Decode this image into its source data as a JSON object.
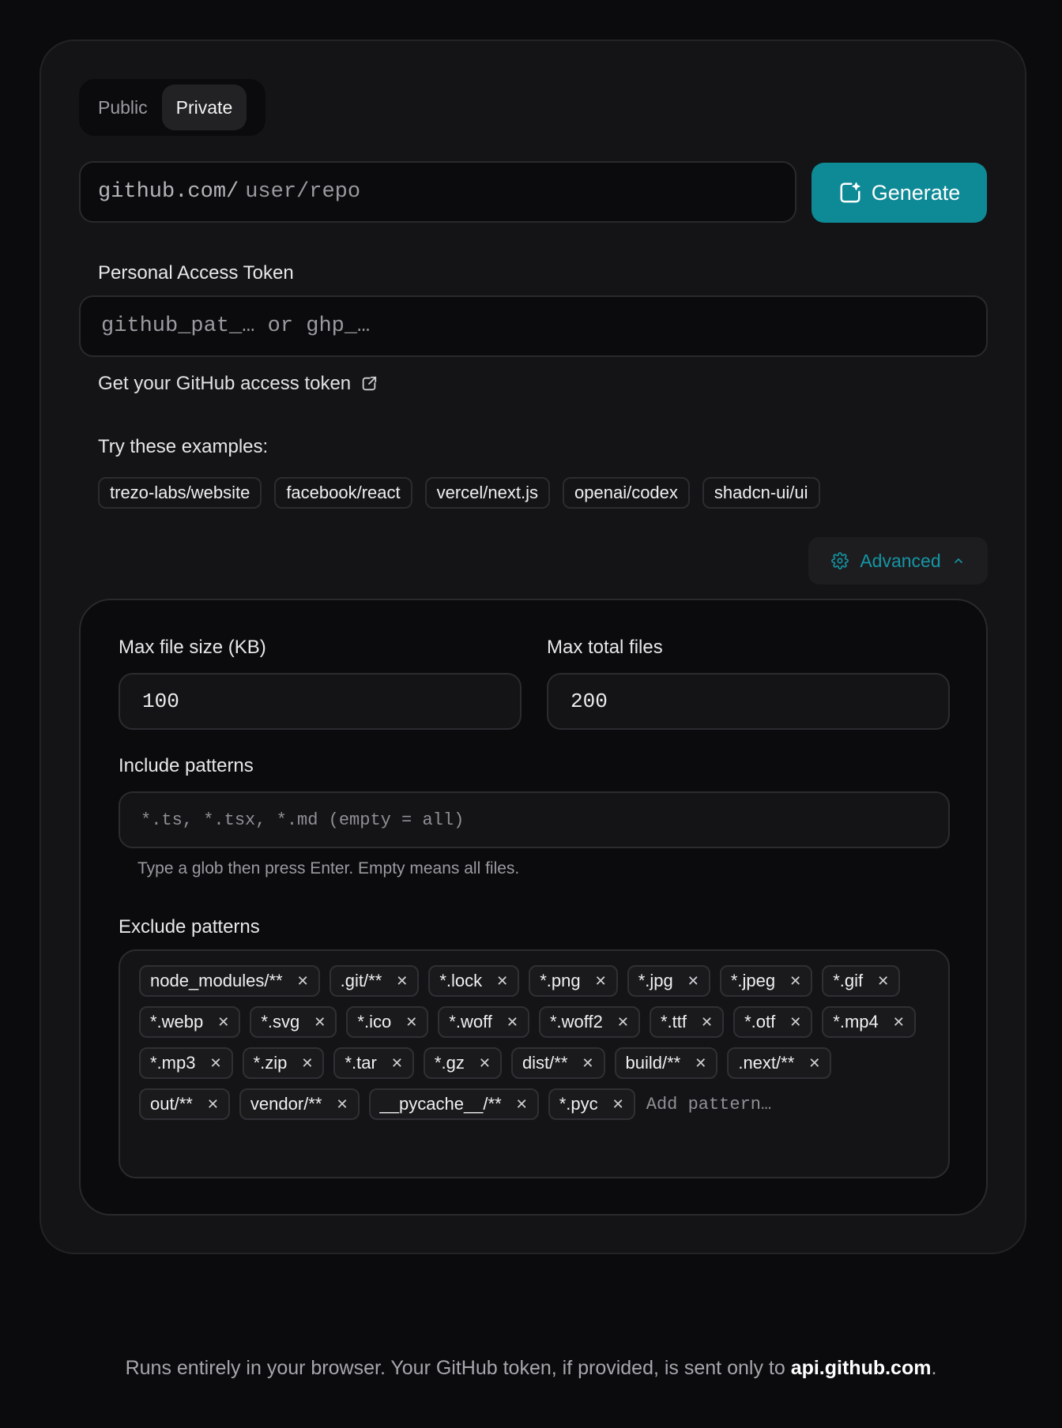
{
  "visibility": {
    "options": [
      "Public",
      "Private"
    ],
    "selected": "Private"
  },
  "repo": {
    "prefix": "github.com/",
    "placeholder": "user/repo"
  },
  "generate": {
    "label": "Generate",
    "icon": "sparkle-square-icon",
    "color": "#0e8a96"
  },
  "token": {
    "label": "Personal Access Token",
    "placeholder": "github_pat_… or ghp_…",
    "link_label": "Get your GitHub access token",
    "link_icon": "external-link-icon"
  },
  "examples": {
    "title": "Try these examples:",
    "items": [
      "trezo-labs/website",
      "facebook/react",
      "vercel/next.js",
      "openai/codex",
      "shadcn-ui/ui"
    ]
  },
  "advanced": {
    "label": "Advanced",
    "icon": "gear-icon",
    "chevron": "chevron-up-icon",
    "color": "#1595a3"
  },
  "settings": {
    "max_file_size_label": "Max file size (KB)",
    "max_file_size_value": "100",
    "max_total_files_label": "Max total files",
    "max_total_files_value": "200",
    "include_label": "Include patterns",
    "include_placeholder": "*.ts, *.tsx, *.md  (empty = all)",
    "include_hint": "Type a glob then press Enter. Empty means all files.",
    "exclude_label": "Exclude patterns",
    "exclude_tags": [
      "node_modules/**",
      ".git/**",
      "*.lock",
      "*.png",
      "*.jpg",
      "*.jpeg",
      "*.gif",
      "*.webp",
      "*.svg",
      "*.ico",
      "*.woff",
      "*.woff2",
      "*.ttf",
      "*.otf",
      "*.mp4",
      "*.mp3",
      "*.zip",
      "*.tar",
      "*.gz",
      "dist/**",
      "build/**",
      ".next/**",
      "out/**",
      "vendor/**",
      "__pycache__/**",
      "*.pyc"
    ],
    "exclude_add_placeholder": "Add pattern…"
  },
  "footer": {
    "text": "Runs entirely in your browser. Your GitHub token, if provided, is sent only to ",
    "host": "api.github.com",
    "end": "."
  }
}
